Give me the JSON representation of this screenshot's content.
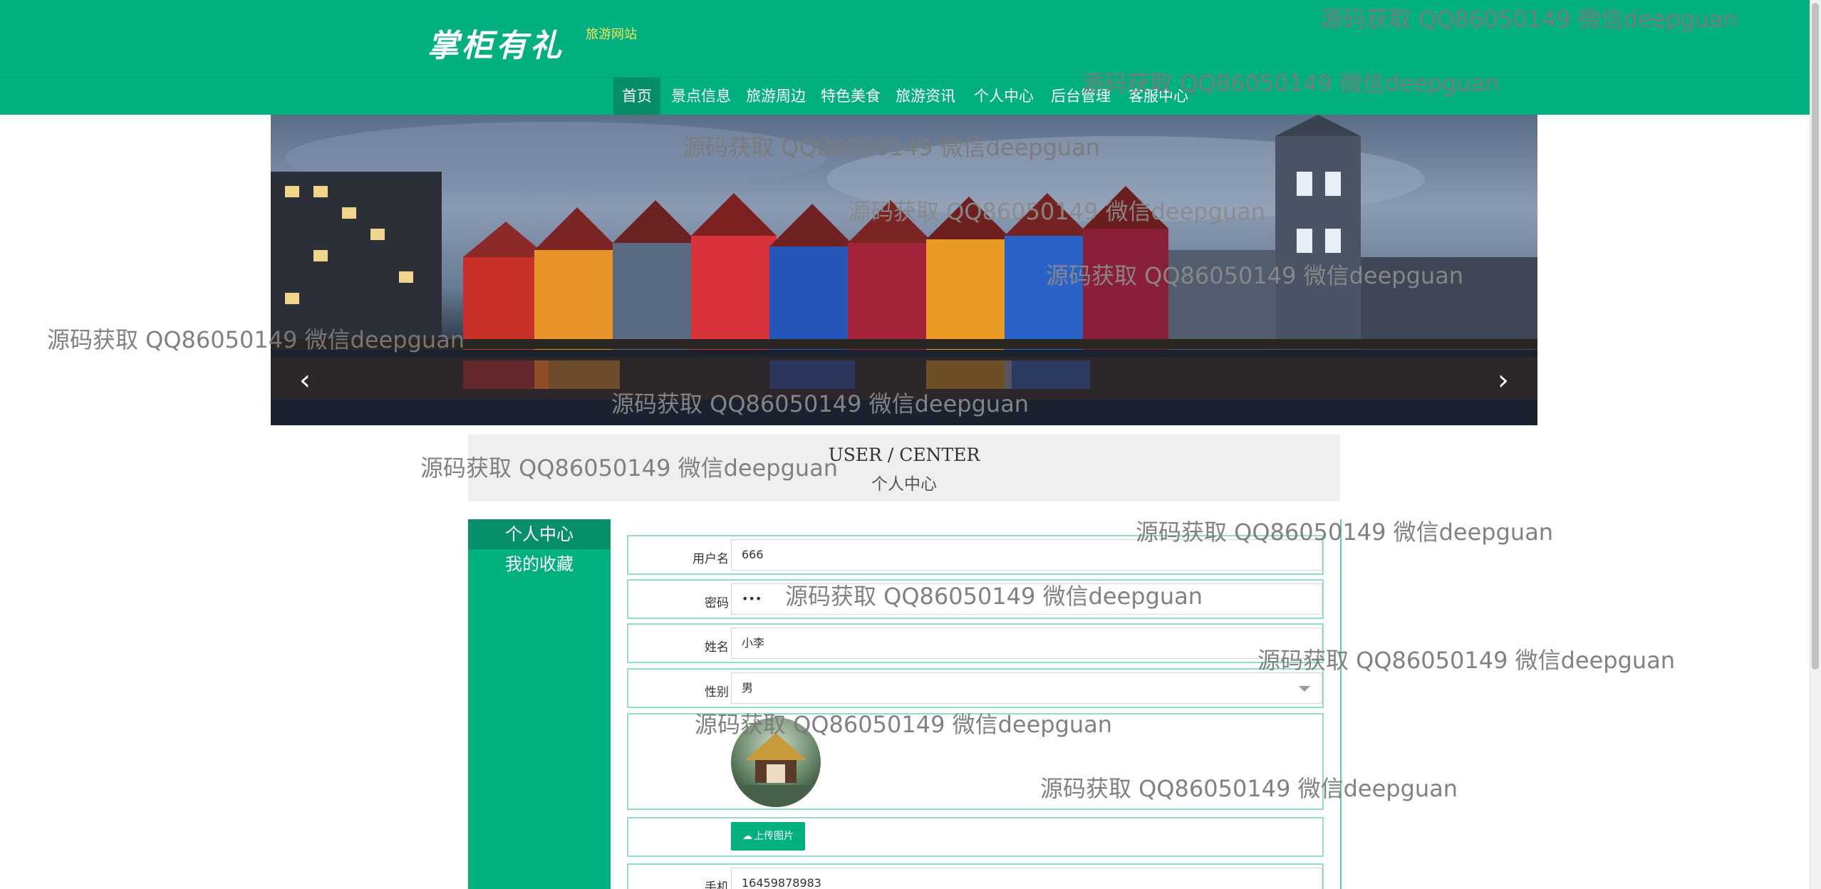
{
  "header": {
    "logo_text": "掌柜有礼",
    "logo_sub": "旅游网站"
  },
  "nav": {
    "items": [
      "首页",
      "景点信息",
      "旅游周边",
      "特色美食",
      "旅游资讯",
      "个人中心",
      "后台管理",
      "客服中心"
    ],
    "active_index": 0
  },
  "banner": {
    "prev_icon": "chevron-left-icon",
    "next_icon": "chevron-right-icon",
    "prev_glyph": "‹",
    "next_glyph": "›"
  },
  "title": {
    "en": "USER / CENTER",
    "cn": "个人中心"
  },
  "sidebar": {
    "items": [
      "个人中心",
      "我的收藏"
    ],
    "active_index": 0
  },
  "form": {
    "username": {
      "label": "用户名",
      "value": "666"
    },
    "password": {
      "label": "密码",
      "value": "•••"
    },
    "name": {
      "label": "姓名",
      "value": "小李"
    },
    "gender": {
      "label": "性别",
      "value": "男"
    },
    "upload": {
      "label": "上传图片",
      "icon": "cloud-upload-icon"
    },
    "phone": {
      "label": "手机",
      "value": "16459878983"
    }
  },
  "watermark": "源码获取 QQ86050149 微信deepguan",
  "colors": {
    "primary": "#00b07f",
    "nav_active": "#078e69",
    "logo_sub": "#f3e85c",
    "watermark": "#7b7b7b"
  }
}
